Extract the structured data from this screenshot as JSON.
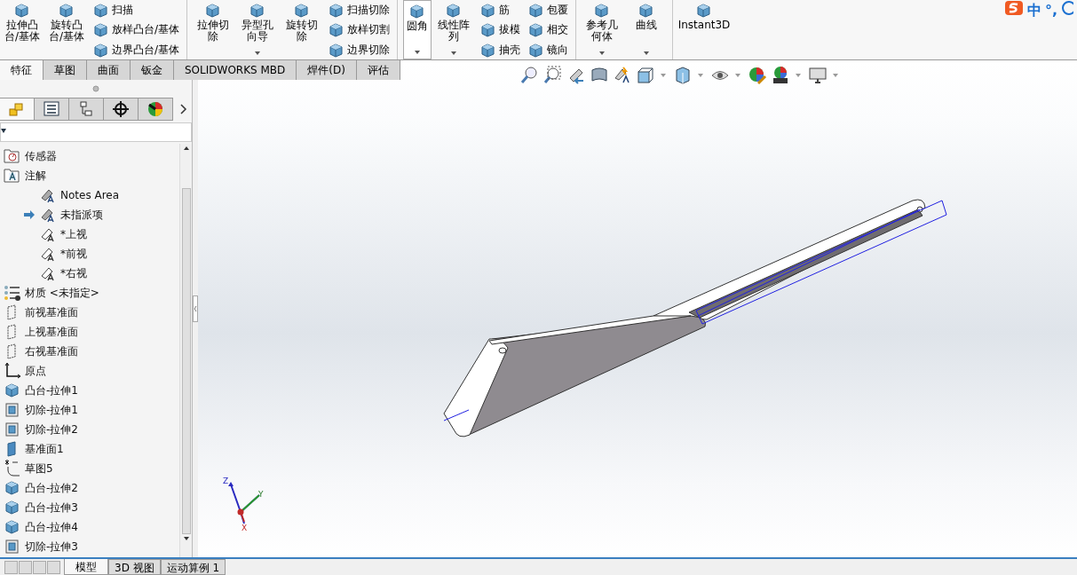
{
  "ribbon": [
    {
      "kind": "large",
      "label": "拉伸凸台/基体",
      "dropdown": false
    },
    {
      "kind": "large",
      "label": "旋转凸台/基体",
      "dropdown": false
    },
    {
      "kind": "column",
      "items": [
        "扫描",
        "放样凸台/基体",
        "边界凸台/基体"
      ]
    },
    {
      "kind": "separator"
    },
    {
      "kind": "large",
      "label": "拉伸切除",
      "dropdown": false
    },
    {
      "kind": "large",
      "label": "异型孔向导",
      "dropdown": true
    },
    {
      "kind": "large",
      "label": "旋转切除",
      "dropdown": false
    },
    {
      "kind": "column",
      "items": [
        "扫描切除",
        "放样切割",
        "边界切除"
      ]
    },
    {
      "kind": "separator"
    },
    {
      "kind": "split",
      "label": "圆角",
      "dropdown": true
    },
    {
      "kind": "large",
      "label": "线性阵列",
      "dropdown": true
    },
    {
      "kind": "column",
      "items": [
        "筋",
        "拔模",
        "抽壳"
      ]
    },
    {
      "kind": "column",
      "items": [
        "包覆",
        "相交",
        "镜向"
      ]
    },
    {
      "kind": "separator"
    },
    {
      "kind": "large",
      "label": "参考几何体",
      "dropdown": true
    },
    {
      "kind": "large",
      "label": "曲线",
      "dropdown": true
    },
    {
      "kind": "separator"
    },
    {
      "kind": "large",
      "label": "Instant3D",
      "dropdown": false
    }
  ],
  "ime": {
    "mode": "中",
    "punct": "°,"
  },
  "command_tabs": [
    {
      "label": "特征",
      "selected": true
    },
    {
      "label": "草图",
      "selected": false
    },
    {
      "label": "曲面",
      "selected": false
    },
    {
      "label": "钣金",
      "selected": false
    },
    {
      "label": "SOLIDWORKS MBD",
      "selected": false
    },
    {
      "label": "焊件(D)",
      "selected": false
    },
    {
      "label": "评估",
      "selected": false
    }
  ],
  "view_toolbar": [
    {
      "kind": "zoom-fit",
      "dropdown": false
    },
    {
      "kind": "zoom-area",
      "dropdown": false
    },
    {
      "kind": "previous",
      "dropdown": false
    },
    {
      "kind": "section",
      "dropdown": false
    },
    {
      "kind": "annotation",
      "dropdown": false
    },
    {
      "kind": "orientation",
      "dropdown": true
    },
    {
      "kind": "display",
      "dropdown": true
    },
    {
      "kind": "eye",
      "dropdown": true
    },
    {
      "kind": "appearance",
      "dropdown": false
    },
    {
      "kind": "scene",
      "dropdown": true
    },
    {
      "kind": "monitor",
      "dropdown": true
    }
  ],
  "panel_tabs": [
    {
      "kind": "tree",
      "selected": true
    },
    {
      "kind": "property",
      "selected": false
    },
    {
      "kind": "config",
      "selected": false
    },
    {
      "kind": "dim",
      "selected": false
    },
    {
      "kind": "display",
      "selected": false
    }
  ],
  "tree": [
    {
      "kind": "sensor",
      "label": "传感器"
    },
    {
      "kind": "annotation",
      "label": "注解",
      "children": [
        {
          "kind": "notes",
          "label": "Notes Area",
          "pointer": false
        },
        {
          "kind": "view",
          "label": "未指派项",
          "pointer": true
        },
        {
          "kind": "view-star",
          "label": "*上视",
          "pointer": false
        },
        {
          "kind": "view-star",
          "label": "*前视",
          "pointer": false
        },
        {
          "kind": "view-star",
          "label": "*右视",
          "pointer": false
        }
      ]
    },
    {
      "kind": "material",
      "label": "材质 <未指定>"
    },
    {
      "kind": "plane",
      "label": "前视基准面"
    },
    {
      "kind": "plane",
      "label": "上视基准面"
    },
    {
      "kind": "plane",
      "label": "右视基准面"
    },
    {
      "kind": "origin",
      "label": "原点"
    },
    {
      "kind": "boss",
      "label": "凸台-拉伸1"
    },
    {
      "kind": "cut",
      "label": "切除-拉伸1"
    },
    {
      "kind": "cut",
      "label": "切除-拉伸2"
    },
    {
      "kind": "refplane",
      "label": "基准面1"
    },
    {
      "kind": "sketch",
      "label": "草图5"
    },
    {
      "kind": "boss",
      "label": "凸台-拉伸2"
    },
    {
      "kind": "boss",
      "label": "凸台-拉伸3"
    },
    {
      "kind": "boss",
      "label": "凸台-拉伸4"
    },
    {
      "kind": "cut",
      "label": "切除-拉伸3"
    }
  ],
  "triad": {
    "z": "Z",
    "y": "Y",
    "x": "X"
  },
  "bottom_tabs": [
    {
      "label": "模型",
      "selected": true
    },
    {
      "label": "3D 视图",
      "selected": false
    },
    {
      "label": "运动算例 1",
      "selected": false
    }
  ]
}
